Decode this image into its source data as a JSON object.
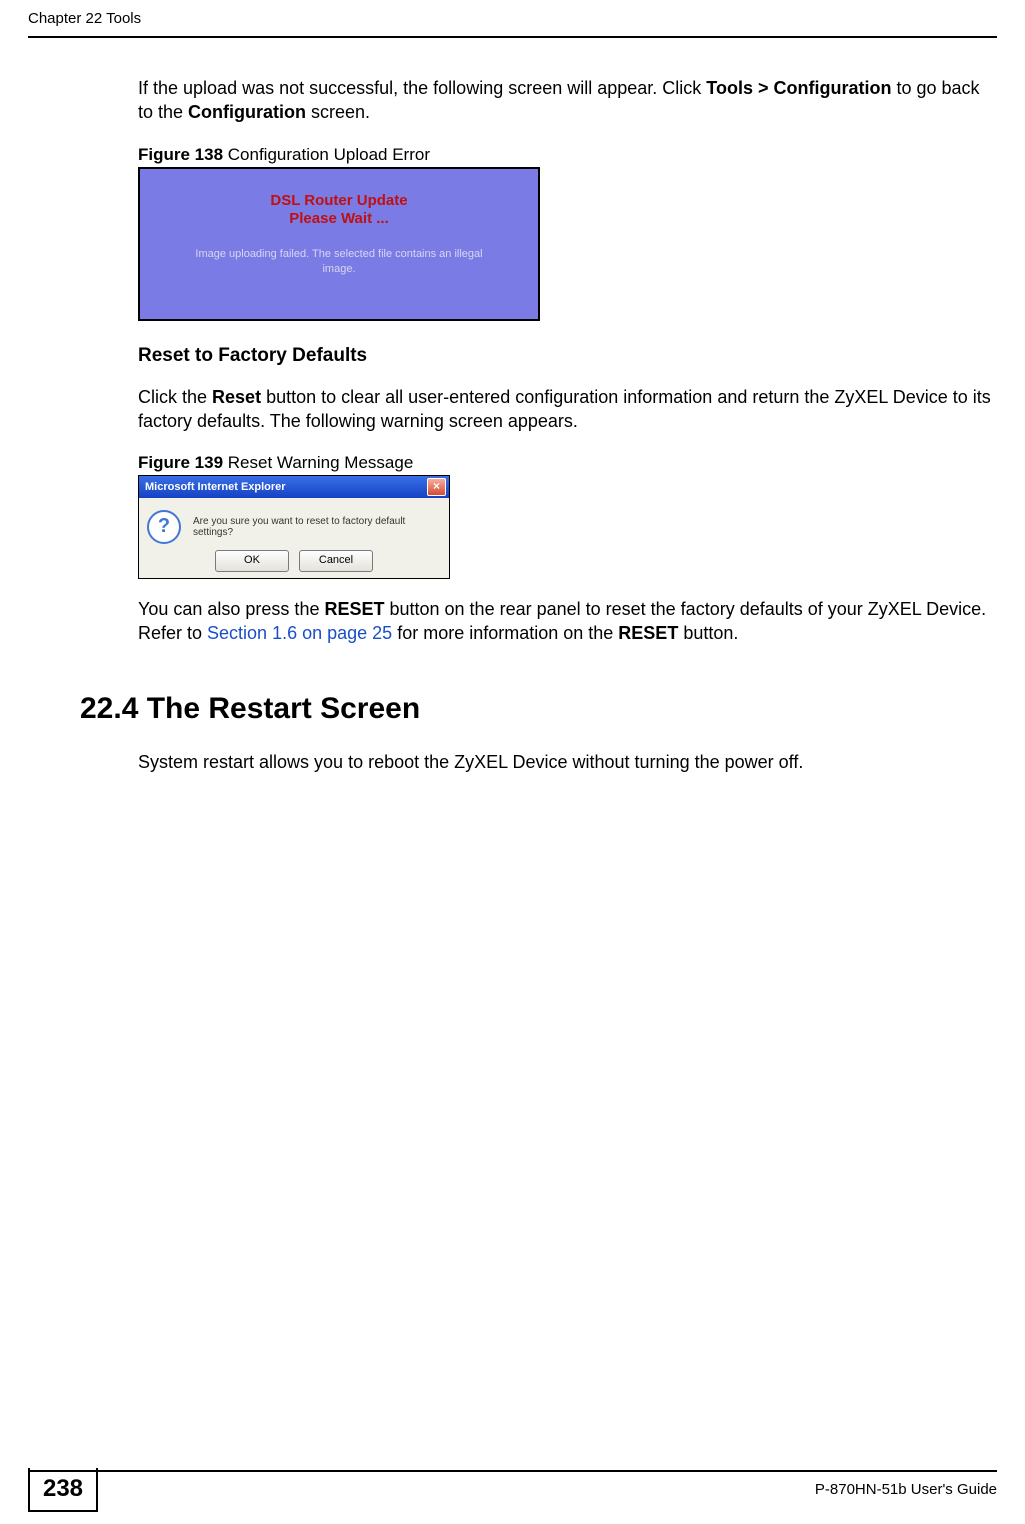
{
  "header": {
    "chapter": "Chapter 22 Tools"
  },
  "intro_para": {
    "pre": "If the upload was not successful, the following screen will appear. Click ",
    "bold1": "Tools > Configuration",
    "mid": " to go back to the ",
    "bold2": "Configuration",
    "post": " screen."
  },
  "fig138": {
    "label_num": "Figure 138",
    "label_txt": "   Configuration Upload Error",
    "title1": "DSL Router Update",
    "title2": "Please Wait ...",
    "subtext": "Image uploading failed. The selected file contains an illegal image."
  },
  "reset_section": {
    "heading": "Reset to Factory Defaults",
    "p_pre": "Click the ",
    "p_bold": "Reset",
    "p_post": " button to clear all user-entered configuration information and return the ZyXEL Device to its factory defaults. The following warning screen appears."
  },
  "fig139": {
    "label_num": "Figure 139",
    "label_txt": "   Reset Warning Message",
    "titlebar": "Microsoft Internet Explorer",
    "msg": "Are you sure you want to reset to factory default settings?",
    "ok": "OK",
    "cancel": "Cancel"
  },
  "after_fig139": {
    "pre": "You can also press the ",
    "bold1": "RESET",
    "mid1": " button on the rear panel to reset the factory defaults of your ZyXEL Device. Refer to ",
    "link": "Section 1.6 on page 25",
    "mid2": " for more information on the ",
    "bold2": "RESET",
    "post": " button."
  },
  "section_224": {
    "heading": "22.4  The Restart Screen",
    "body": "System restart allows you to reboot the ZyXEL Device without turning the power off."
  },
  "footer": {
    "page_num": "238",
    "guide": "P-870HN-51b User's Guide"
  }
}
